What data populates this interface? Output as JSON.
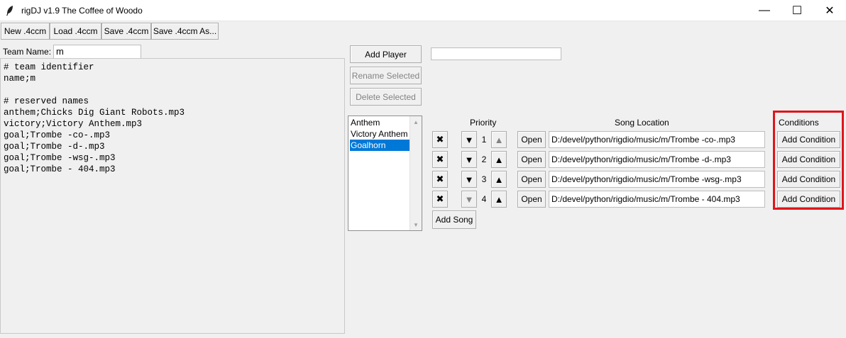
{
  "window": {
    "title": "rigDJ v1.9 The Coffee of Woodo",
    "controls": {
      "minimize": "—",
      "maximize": "☐",
      "close": "✕"
    }
  },
  "toolbar": {
    "new": "New .4ccm",
    "load": "Load .4ccm",
    "save": "Save .4ccm",
    "save_as": "Save .4ccm As..."
  },
  "team": {
    "label": "Team Name:",
    "value": "m"
  },
  "config_text": "# team identifier\nname;m\n\n# reserved names\nanthem;Chicks Dig Giant Robots.mp3\nvictory;Victory Anthem.mp3\ngoal;Trombe -co-.mp3\ngoal;Trombe -d-.mp3\ngoal;Trombe -wsg-.mp3\ngoal;Trombe - 404.mp3",
  "players": {
    "add": "Add Player",
    "rename": "Rename Selected",
    "delete": "Delete Selected",
    "new_name": "",
    "items": [
      "Anthem",
      "Victory Anthem",
      "Goalhorn"
    ],
    "selected_index": 2
  },
  "songs": {
    "headers": {
      "priority": "Priority",
      "location": "Song Location",
      "conditions": "Conditions"
    },
    "remove_symbol": "✖",
    "down_symbol": "▼",
    "up_symbol": "▲",
    "open_label": "Open",
    "add_condition_label": "Add Condition",
    "add_song": "Add Song",
    "rows": [
      {
        "priority": "1",
        "path": "D:/devel/python/rigdio/music/m/Trombe -co-.mp3"
      },
      {
        "priority": "2",
        "path": "D:/devel/python/rigdio/music/m/Trombe -d-.mp3"
      },
      {
        "priority": "3",
        "path": "D:/devel/python/rigdio/music/m/Trombe -wsg-.mp3"
      },
      {
        "priority": "4",
        "path": "D:/devel/python/rigdio/music/m/Trombe - 404.mp3"
      }
    ]
  },
  "colors": {
    "highlight": "#e0151c",
    "selection": "#0078d7"
  }
}
